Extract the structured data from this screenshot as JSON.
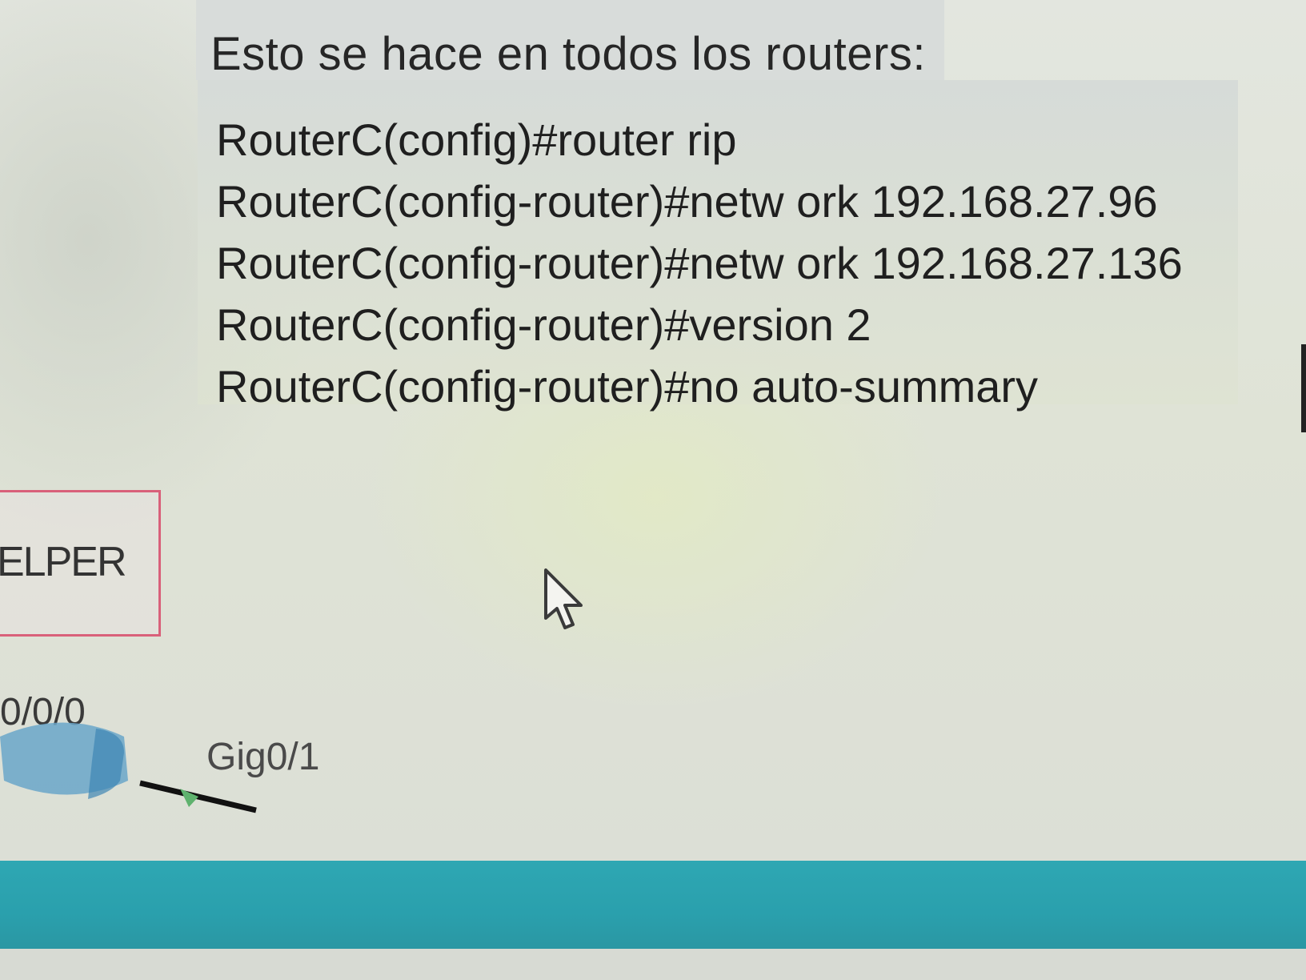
{
  "note": {
    "title": "Esto se hace en todos los routers:",
    "commands": [
      "RouterC(config)#router rip",
      "RouterC(config-router)#netw ork 192.168.27.96",
      "RouterC(config-router)#netw ork 192.168.27.136",
      "RouterC(config-router)#version 2",
      "RouterC(config-router)#no auto-summary"
    ]
  },
  "topology": {
    "helper_label": "ELPER",
    "interface_left": "0/0/0",
    "interface_gig": "Gig0/1"
  },
  "colors": {
    "taskbar": "#2ea7b3",
    "helper_border": "#d9607a"
  },
  "icons": [
    "router-icon",
    "cursor-arrow-icon"
  ]
}
